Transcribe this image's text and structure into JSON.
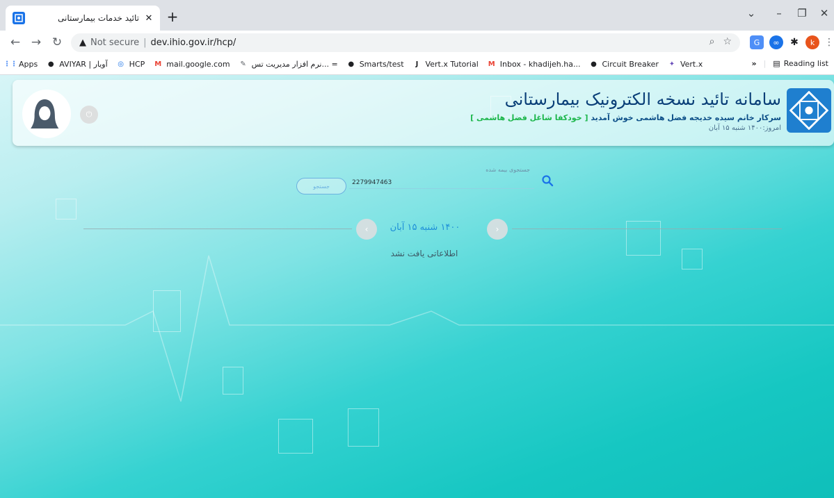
{
  "browser": {
    "tab_title": "تائید خدمات بیمارستانی",
    "tab_close": "✕",
    "new_tab": "+",
    "win_minimize": "–",
    "win_restore": "❐",
    "win_close": "✕",
    "win_chevron": "⌄",
    "security_label": "Not secure",
    "url": "dev.ihio.gov.ir/hcp/",
    "profile_letter": "k",
    "bookmarks": [
      {
        "label": "Apps",
        "icon": "apps-grid-icon"
      },
      {
        "label": "AVIYAR | آویار",
        "icon": "globe-icon"
      },
      {
        "label": "HCP",
        "icon": "hcp-logo-icon"
      },
      {
        "label": "mail.google.com",
        "icon": "gmail-icon"
      },
      {
        "label": "نرم افزار مدیریت تس... =",
        "icon": "app-icon"
      },
      {
        "label": "Smarts/test",
        "icon": "globe-icon"
      },
      {
        "label": "Vert.x Tutorial",
        "icon": "j-icon"
      },
      {
        "label": "Inbox - khadijeh.ha...",
        "icon": "gmail-icon"
      },
      {
        "label": "Circuit Breaker",
        "icon": "globe-icon"
      },
      {
        "label": "Vert.x",
        "icon": "vertx-icon"
      }
    ],
    "more_bookmarks": "»",
    "reading_list": "Reading list"
  },
  "header": {
    "title": "سامانه تائید نسخه الکترونیک بیمارستانی",
    "welcome_prefix": "سرکار خانم سیده خدیجه فضل هاشمی خوش آمدید",
    "welcome_highlight": "[ خودکفا شاغل فضل هاشمی ]",
    "today": "امروز:۱۴۰۰ شنبه ۱۵ آبان",
    "power_icon": "⏻"
  },
  "search": {
    "caption": "جستجوی بیمه شده",
    "value": "2279947463",
    "button_label": "جستجو"
  },
  "date_nav": {
    "label": "۱۴۰۰ شنبه ۱۵ آبان",
    "prev": "‹",
    "next": "›"
  },
  "result": {
    "message": "اطلاعاتی یافت نشد"
  },
  "colors": {
    "accent": "#1e8fd8",
    "title": "#0a3f78",
    "highlight_green": "#1cb64b"
  }
}
